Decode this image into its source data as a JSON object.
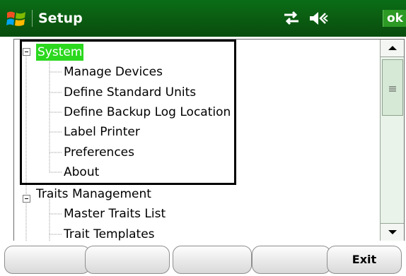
{
  "titlebar": {
    "title": "Setup",
    "ok_label": "ok",
    "icons": [
      "windows-start-icon",
      "connectivity-icon",
      "volume-icon"
    ]
  },
  "tree": {
    "nodes": [
      {
        "label": "System",
        "level": 0,
        "expanded": true,
        "selected": true
      },
      {
        "label": "Manage Devices",
        "level": 1
      },
      {
        "label": "Define Standard Units",
        "level": 1
      },
      {
        "label": "Define Backup Log Location",
        "level": 1
      },
      {
        "label": "Label Printer",
        "level": 1
      },
      {
        "label": "Preferences",
        "level": 1
      },
      {
        "label": "About",
        "level": 1
      },
      {
        "label": "Traits Management",
        "level": 0,
        "expanded": true
      },
      {
        "label": "Master Traits List",
        "level": 1
      },
      {
        "label": "Trait Templates",
        "level": 1
      }
    ]
  },
  "softkeys": [
    "",
    "",
    "",
    "",
    "Exit"
  ],
  "colors": {
    "titlebar": "#0b5e12",
    "selected": "#2bd81e",
    "ok_button": "#2c9a24"
  }
}
